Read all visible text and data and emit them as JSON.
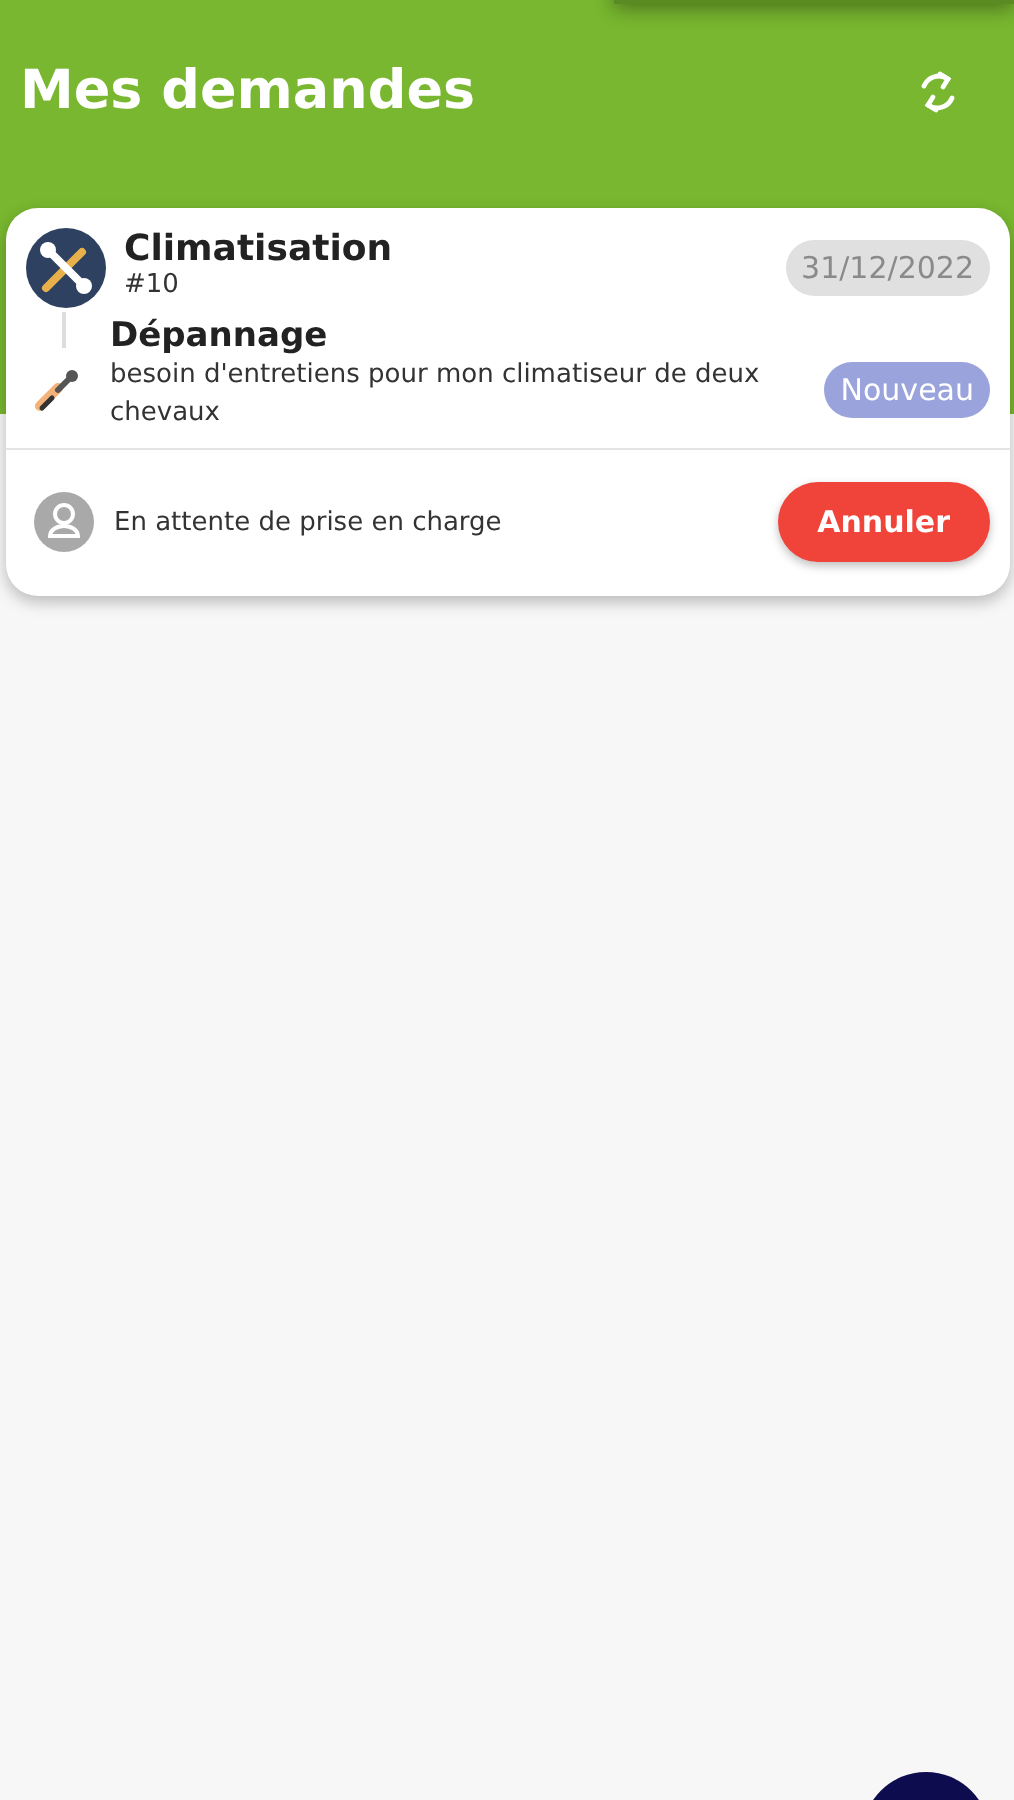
{
  "header": {
    "title": "Mes demandes"
  },
  "requests": [
    {
      "category": "Climatisation",
      "number": "#10",
      "date": "31/12/2022",
      "service": "Dépannage",
      "description": "besoin d'entretiens pour mon climatiseur de deux chevaux",
      "status_badge": "Nouveau",
      "status_text": "En attente de prise en charge",
      "action": "Annuler"
    }
  ]
}
